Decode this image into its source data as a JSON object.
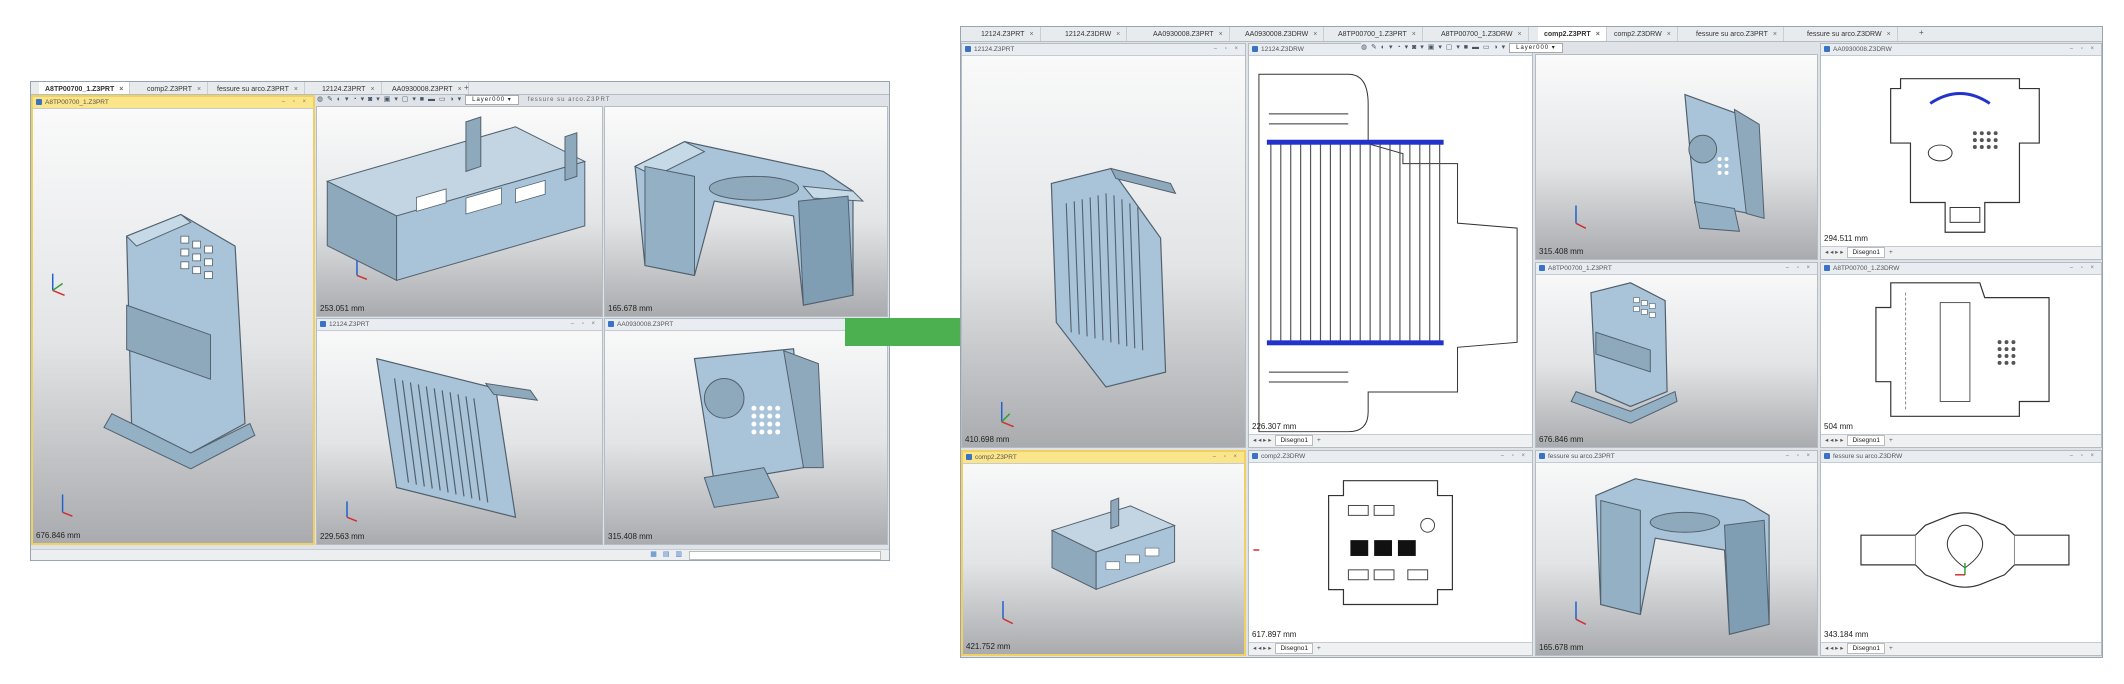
{
  "colors": {
    "arrow": "#4caf50",
    "part": "#a9c4d8",
    "active_pane": "#fbe58a"
  },
  "left_window": {
    "tabs": [
      {
        "label": "A8TP00700_1.Z3PRT",
        "active": true
      },
      {
        "label": "comp2.Z3PRT",
        "active": false
      },
      {
        "label": "fessure su arco.Z3PRT",
        "active": false
      },
      {
        "label": "12124.Z3PRT",
        "active": false
      },
      {
        "label": "AA0930008.Z3PRT",
        "active": false
      }
    ],
    "layer": "Layer000",
    "extra_tab": "fessure su arco.Z3PRT",
    "panes": [
      {
        "title": "A8TP00700_1.Z3PRT",
        "scale": "676.846 mm"
      },
      {
        "title": "",
        "scale": "253.051 mm"
      },
      {
        "title": "",
        "scale": "165.678 mm"
      },
      {
        "title": "12124.Z3PRT",
        "scale": "229.563 mm"
      },
      {
        "title": "AA0930008.Z3PRT",
        "scale": "315.408 mm"
      }
    ]
  },
  "right_window": {
    "tabs": [
      {
        "label": "12124.Z3PRT"
      },
      {
        "label": "12124.Z3DRW"
      },
      {
        "label": "AA0930008.Z3PRT"
      },
      {
        "label": "AA0930008.Z3DRW"
      },
      {
        "label": "A8TP00700_1.Z3PRT"
      },
      {
        "label": "A8TP00700_1.Z3DRW"
      },
      {
        "label": "comp2.Z3PRT"
      },
      {
        "label": "comp2.Z3DRW"
      },
      {
        "label": "fessure su arco.Z3PRT"
      },
      {
        "label": "fessure su arco.Z3DRW"
      }
    ],
    "layer": "Layer000",
    "sheet_label": "Disegno1",
    "panes": [
      {
        "title": "12124.Z3PRT",
        "scale": "410.698 mm"
      },
      {
        "title": "12124.Z3DRW",
        "scale": "226.307 mm"
      },
      {
        "title": "",
        "scale": "315.408 mm"
      },
      {
        "title": "AA0930008.Z3DRW",
        "scale": "294.511 mm"
      },
      {
        "title": "A8TP00700_1.Z3PRT",
        "scale": "676.846 mm"
      },
      {
        "title": "A8TP00700_1.Z3DRW",
        "scale": "504 mm"
      },
      {
        "title": "comp2.Z3PRT",
        "scale": "421.752 mm"
      },
      {
        "title": "comp2.Z3DRW",
        "scale": "617.897 mm"
      },
      {
        "title": "fessure su arco.Z3PRT",
        "scale": "165.678 mm"
      },
      {
        "title": "fessure su arco.Z3DRW",
        "scale": "343.184 mm"
      }
    ]
  }
}
